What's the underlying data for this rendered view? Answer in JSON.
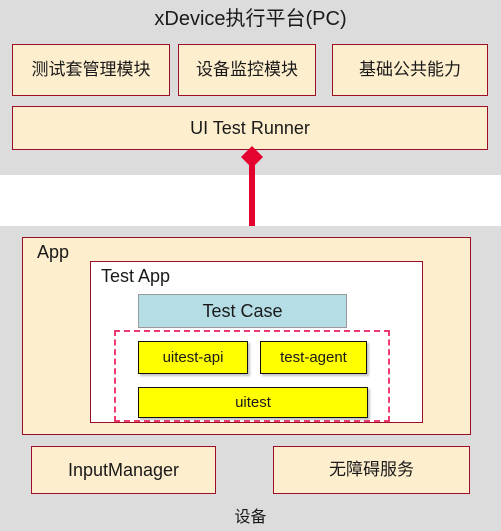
{
  "colors": {
    "panel_background": "#dcdcdc",
    "page_background": "#ffffff",
    "box_fill_cream": "#fdeecd",
    "box_fill_white": "#ffffff",
    "box_fill_blue": "#b4dde6",
    "box_fill_yellow": "#ffff00",
    "box_border_dark_red": "#9e0b2b",
    "dashed_border_pink": "#ed3b6e",
    "arrow_red": "#e4032e",
    "text": "#1a1a1a"
  },
  "pc_panel": {
    "title": "xDevice执行平台(PC)",
    "modules": [
      {
        "label": "测试套管理模块"
      },
      {
        "label": "设备监控模块"
      },
      {
        "label": "基础公共能力"
      }
    ],
    "runner": {
      "label": "UI Test Runner"
    }
  },
  "connector": {
    "icon": "up-arrow-icon",
    "direction": "up",
    "color": "#e4032e"
  },
  "device_panel": {
    "title": "设备",
    "app": {
      "label": "App",
      "test_app": {
        "label": "Test App",
        "test_case": {
          "label": "Test Case"
        },
        "framework_group": {
          "boxes": [
            {
              "label": "uitest-api"
            },
            {
              "label": "test-agent"
            },
            {
              "label": "uitest"
            }
          ]
        }
      }
    },
    "services": [
      {
        "label": "InputManager"
      },
      {
        "label": "无障碍服务"
      }
    ]
  }
}
